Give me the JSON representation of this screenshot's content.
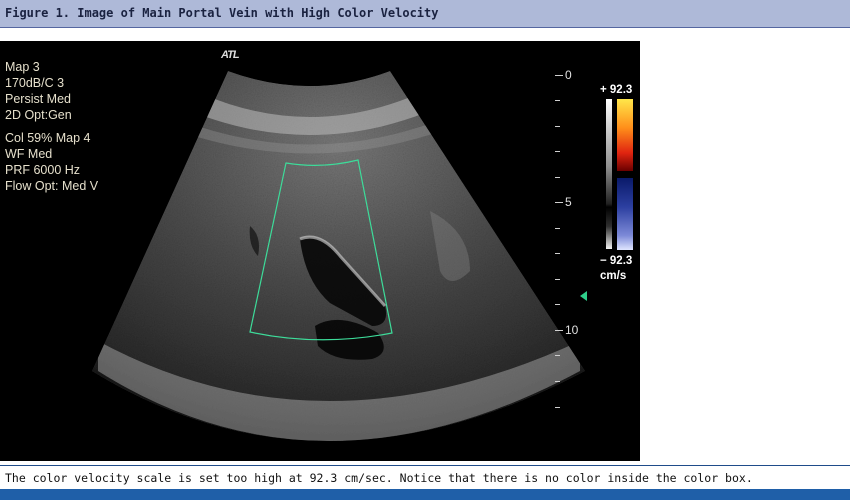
{
  "figure": {
    "title": "Figure 1. Image of Main Portal Vein with High Color Velocity",
    "caption": "The color velocity scale is set too high at 92.3 cm/sec. Notice that there is no color inside the color box."
  },
  "ultrasound": {
    "logo": "ATL",
    "settings_block_a": [
      "Map 3",
      "170dB/C 3",
      "Persist Med",
      "2D Opt:Gen"
    ],
    "settings_block_b": [
      "Col 59%  Map 4",
      "WF Med",
      "PRF 6000  Hz",
      "Flow Opt: Med V"
    ],
    "depth_scale": {
      "labels": [
        "0",
        "5",
        "10"
      ]
    },
    "color_scale": {
      "max": "+ 92.3",
      "min": "− 92.3",
      "unit": "cm/s"
    },
    "colors": {
      "background": "#000000",
      "color_box_outline": "#3ddc9a",
      "focus_marker": "#2ecf8a"
    }
  }
}
